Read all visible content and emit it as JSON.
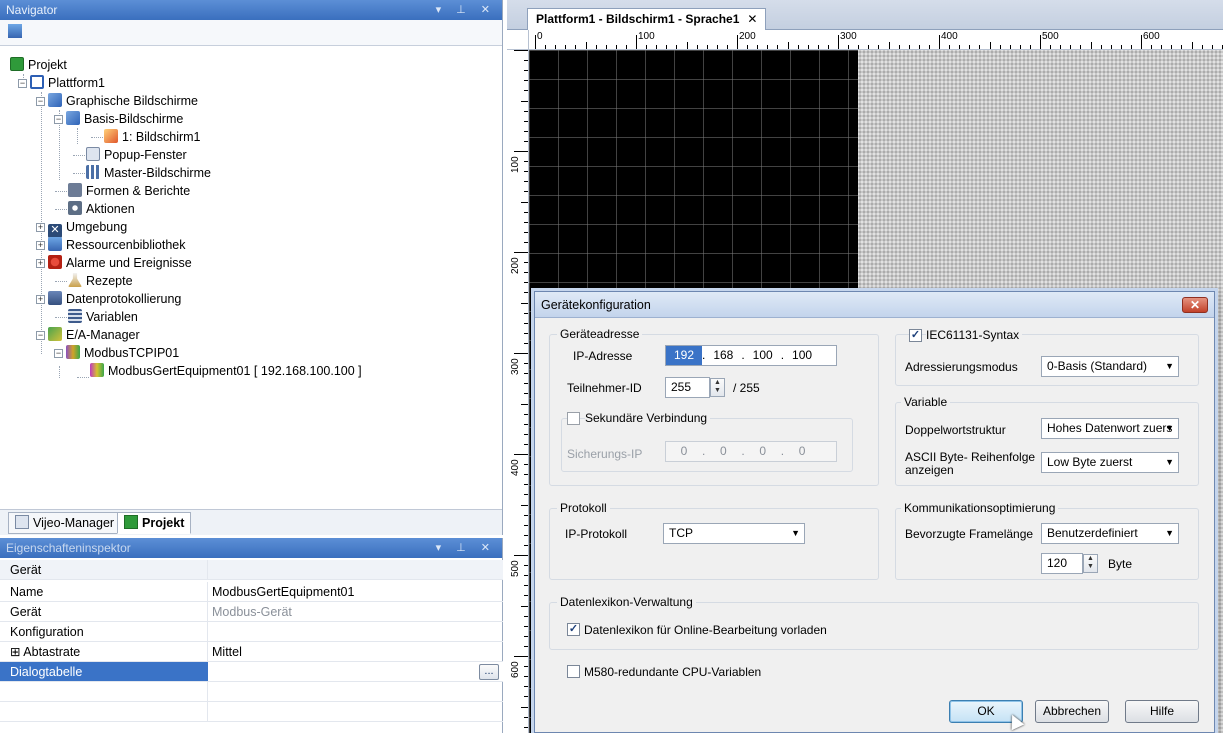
{
  "navigator": {
    "title": "Navigator",
    "window_controls": "▾ ⊥ ✕",
    "tree": {
      "projekt": "Projekt",
      "plattform1": "Plattform1",
      "graphische_bildschirme": "Graphische Bildschirme",
      "basis_bildschirme": "Basis-Bildschirme",
      "bildschirm1": "1: Bildschirm1",
      "popup_fenster": "Popup-Fenster",
      "master_bildschirme": "Master-Bildschirme",
      "formen_berichte": "Formen & Berichte",
      "aktionen": "Aktionen",
      "umgebung": "Umgebung",
      "ressourcenbibliothek": "Ressourcenbibliothek",
      "alarme": "Alarme und Ereignisse",
      "rezepte": "Rezepte",
      "datenprotokollierung": "Datenprotokollierung",
      "variablen": "Variablen",
      "ea_manager": "E/A-Manager",
      "modbus_tcpip": "ModbusTCPIP01",
      "modbus_equipment": "ModbusGertEquipment01 [ 192.168.100.100 ]"
    },
    "tabs": {
      "vijeo_manager": "Vijeo-Manager",
      "projekt": "Projekt"
    }
  },
  "inspector": {
    "title": "Eigenschafteninspektor",
    "window_controls": "▾ ⊥ ✕",
    "section": "Gerät",
    "rows": [
      {
        "key": "Name",
        "value": "ModbusGertEquipment01"
      },
      {
        "key": "Gerät",
        "value": "Modbus-Gerät"
      },
      {
        "key": "Konfiguration",
        "value": ""
      },
      {
        "key": "Abtastrate",
        "value": "Mittel",
        "expand": "⊞"
      },
      {
        "key": "Dialogtabelle",
        "value": ""
      }
    ],
    "ellipsis": "..."
  },
  "editor": {
    "tab_title": "Plattform1 - Bildschirm1 - Sprache1",
    "tab_close": "✕",
    "ruler_top": [
      "0",
      "100",
      "200",
      "300",
      "400",
      "500",
      "600"
    ],
    "ruler_left": [
      "100",
      "200",
      "300",
      "400",
      "500",
      "600"
    ]
  },
  "dialog": {
    "title": "Gerätekonfiguration",
    "close": "✕",
    "geraeteadresse": {
      "legend": "Geräteadresse",
      "ip_label": "IP-Adresse",
      "ip": [
        "192",
        "168",
        "100",
        "100"
      ],
      "teilnehmer_label": "Teilnehmer-ID",
      "teilnehmer_value": "255",
      "teilnehmer_max": "/ 255",
      "sek_label": "Sekundäre Verbindung",
      "sicherungs_label": "Sicherungs-IP",
      "sicherungs_ip": [
        "0",
        "0",
        "0",
        "0"
      ]
    },
    "protokoll": {
      "legend": "Protokoll",
      "label": "IP-Protokoll",
      "value": "TCP"
    },
    "iec": {
      "label": "IEC61131-Syntax",
      "checked": true,
      "adress_label": "Adressierungsmodus",
      "adress_value": "0-Basis (Standard)"
    },
    "variable": {
      "legend": "Variable",
      "dword_label": "Doppelwortstruktur",
      "dword_value": "Hohes Datenwort zuers",
      "ascii_label_1": "ASCII Byte- Reihenfolge",
      "ascii_label_2": "anzeigen",
      "ascii_value": "Low Byte zuerst"
    },
    "kommunikation": {
      "legend": "Kommunikationsoptimierung",
      "frame_label": "Bevorzugte Framelänge",
      "frame_value": "Benutzerdefiniert",
      "byte_value": "120",
      "byte_unit": "Byte"
    },
    "datenlexikon": {
      "legend": "Datenlexikon-Verwaltung",
      "label": "Datenlexikon für Online-Bearbeitung vorladen",
      "checked": true
    },
    "m580": {
      "label": "M580-redundante CPU-Variablen",
      "checked": false
    },
    "buttons": {
      "ok": "OK",
      "cancel": "Abbrechen",
      "help": "Hilfe"
    }
  }
}
